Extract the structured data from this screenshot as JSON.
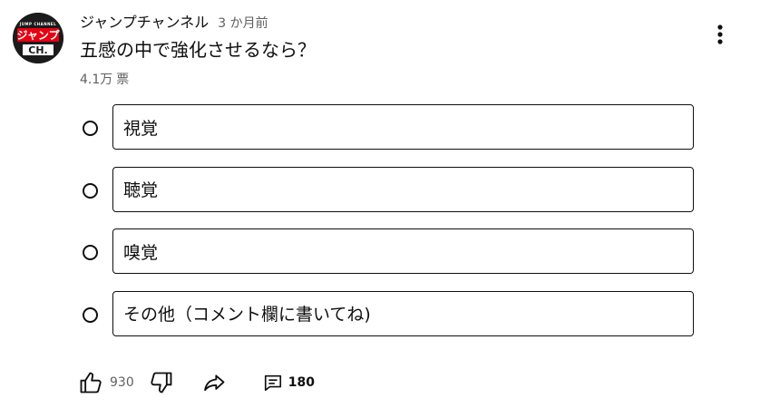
{
  "post": {
    "channel_name": "ジャンプチャンネル",
    "time_ago": "3 か月前",
    "question": "五感の中で強化させるなら？",
    "vote_count": "4.1万",
    "vote_unit": "票"
  },
  "options": [
    {
      "label": "視覚"
    },
    {
      "label": "聴覚"
    },
    {
      "label": "嗅覚"
    },
    {
      "label": "その他（コメント欄に書いてね)"
    }
  ],
  "actions": {
    "like_count": "930",
    "comment_count": "180"
  },
  "icons": {
    "menu": "more-vert-icon",
    "like": "thumb-up-icon",
    "dislike": "thumb-down-icon",
    "share": "share-icon",
    "comment": "comment-icon"
  },
  "colors": {
    "text_primary": "#0f0f0f",
    "text_secondary": "#606060",
    "logo_red": "#e60012"
  },
  "avatar": {
    "logo_text": "ジャンプ",
    "logo_sub": "CH.",
    "logo_top": "JUMP CHANNEL"
  }
}
